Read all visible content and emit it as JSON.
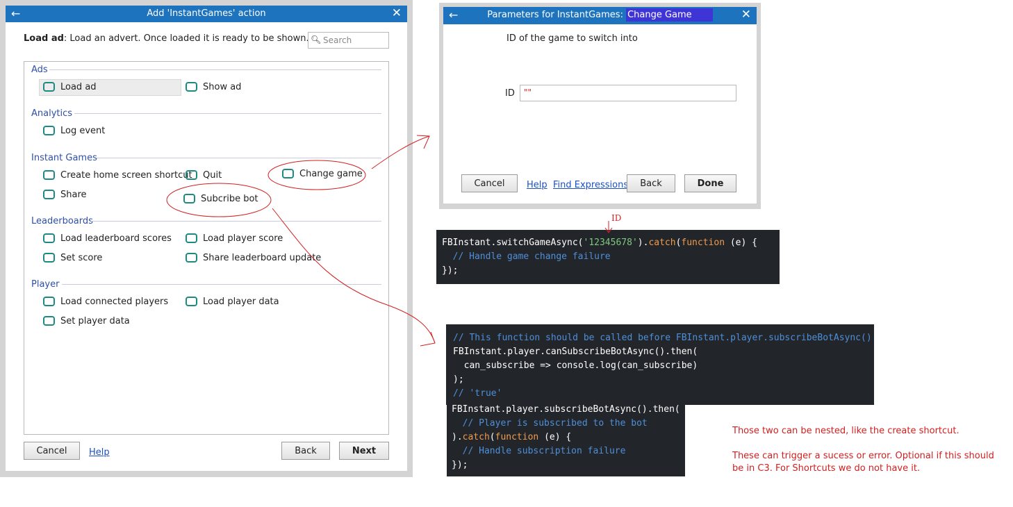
{
  "main_dialog": {
    "title": "Add 'InstantGames' action",
    "back_icon": "←",
    "close_icon": "✕",
    "description_bold": "Load ad",
    "description_rest": ": Load an advert. Once loaded it is ready to be shown.",
    "search_placeholder": "Search",
    "groups": {
      "ads": {
        "label": "Ads",
        "items": [
          "Load ad",
          "Show ad"
        ]
      },
      "analytics": {
        "label": "Analytics",
        "items": [
          "Log event"
        ]
      },
      "instant_games": {
        "label": "Instant Games",
        "items": [
          "Create home screen shortcut",
          "Quit",
          "Change game",
          "Share",
          "Subcribe bot"
        ]
      },
      "leaderboards": {
        "label": "Leaderboards",
        "items": [
          "Load leaderboard scores",
          "Load player score",
          "Set score",
          "Share leaderboard update"
        ]
      },
      "player": {
        "label": "Player",
        "items": [
          "Load connected players",
          "Load player data",
          "Set player data"
        ]
      }
    },
    "buttons": {
      "cancel": "Cancel",
      "help": "Help",
      "back": "Back",
      "next": "Next"
    }
  },
  "params_dialog": {
    "title_prefix": "Parameters for InstantGames: ",
    "title_highlight": "Change Game",
    "param_description": "ID of the game to switch into",
    "id_label": "ID",
    "id_value": "\"\"",
    "buttons": {
      "cancel": "Cancel",
      "help": "Help",
      "find_expressions": "Find Expressions",
      "back": "Back",
      "done": "Done"
    }
  },
  "annotation_id": "ID",
  "code_switch": {
    "l1_a": "FBInstant.switchGameAsync(",
    "l1_str": "'12345678'",
    "l1_b": ").",
    "l1_catch": "catch",
    "l1_c": "(",
    "l1_fn": "function",
    "l1_d": " (e) {",
    "l2": "  // Handle game change failure",
    "l3": "});"
  },
  "code_subscribe_check": {
    "l1": "// This function should be called before FBInstant.player.subscribeBotAsync()",
    "l2": "FBInstant.player.canSubscribeBotAsync().then(",
    "l3": "  can_subscribe => console.log(can_subscribe)",
    "l4": ");",
    "l5": "// 'true'"
  },
  "code_subscribe": {
    "l1": "FBInstant.player.subscribeBotAsync().then(",
    "l2": "  // Player is subscribed to the bot",
    "l3_a": ").",
    "l3_catch": "catch",
    "l3_b": "(",
    "l3_fn": "function",
    "l3_c": " (e) {",
    "l4": "  // Handle subscription failure",
    "l5": "});"
  },
  "notes": {
    "line1": "Those two can be nested, like the create shortcut.",
    "line2": "These can trigger a sucess or error. Optional if this should",
    "line3": "be in C3. For Shortcuts we do not have it."
  },
  "colors": {
    "titlebar": "#1e73be",
    "group_label": "#2d4fa8",
    "annotation_red": "#d11f1f",
    "code_bg": "#22262b"
  }
}
